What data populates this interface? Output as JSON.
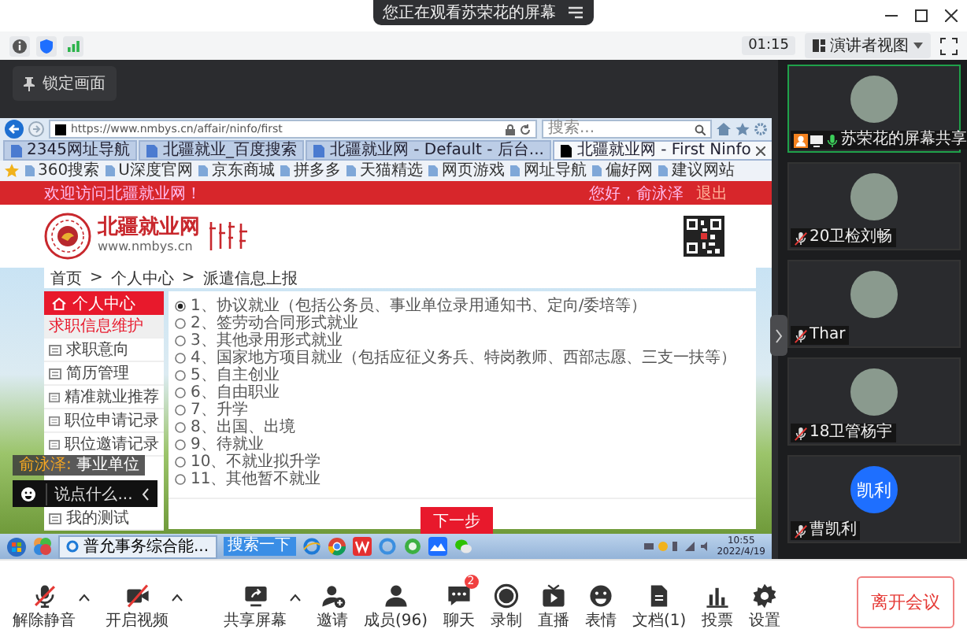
{
  "banner": {
    "text": "您正在观看苏荣花的屏幕"
  },
  "toolbar": {
    "timer": "01:15",
    "view_button": "演讲者视图"
  },
  "lock_button": "锁定画面",
  "browser": {
    "url": "https://www.nmbys.cn/affair/ninfo/first",
    "search_placeholder": "搜索...",
    "tabs": [
      {
        "label": "2345网址导航",
        "selected": false
      },
      {
        "label": "北疆就业_百度搜索",
        "selected": false
      },
      {
        "label": "北疆就业网 - Default - 后台...",
        "selected": false
      },
      {
        "label": "北疆就业网 - First Ninfo",
        "selected": true
      }
    ],
    "favorites": [
      "360搜索",
      "U深度官网",
      "京东商城",
      "拼多多",
      "天猫精选",
      "网页游戏",
      "网址导航",
      "偏好网",
      "建议网站"
    ]
  },
  "site": {
    "welcome": "欢迎访问北疆就业网！",
    "greeting": "您好，俞泳泽",
    "logout": "退出",
    "logo_title": "北疆就业网",
    "logo_url": "www.nmbys.cn"
  },
  "breadcrumb": {
    "separator": ">",
    "items": [
      "首页",
      "个人中心",
      "派遣信息上报"
    ]
  },
  "sidebar": {
    "title": "个人中心",
    "items": [
      {
        "label": "求职信息维护",
        "selected": true
      },
      {
        "label": "求职意向",
        "selected": false
      },
      {
        "label": "简历管理",
        "selected": false
      },
      {
        "label": "精准就业推荐",
        "selected": false
      },
      {
        "label": "职位申请记录",
        "selected": false
      },
      {
        "label": "职位邀请记录",
        "selected": false
      },
      {
        "label": "我的测试",
        "selected": false
      }
    ]
  },
  "form": {
    "options": [
      {
        "label": "1、协议就业（包括公务员、事业单位录用通知书、定向/委培等）",
        "selected": true
      },
      {
        "label": "2、签劳动合同形式就业",
        "selected": false
      },
      {
        "label": "3、其他录用形式就业",
        "selected": false
      },
      {
        "label": "4、国家地方项目就业（包括应征义务兵、特岗教师、西部志愿、三支一扶等）",
        "selected": false
      },
      {
        "label": "5、自主创业",
        "selected": false
      },
      {
        "label": "6、自由职业",
        "selected": false
      },
      {
        "label": "7、升学",
        "selected": false
      },
      {
        "label": "8、出国、出境",
        "selected": false
      },
      {
        "label": "9、待就业",
        "selected": false
      },
      {
        "label": "10、不就业拟升学",
        "selected": false
      },
      {
        "label": "11、其他暂不就业",
        "selected": false
      }
    ],
    "next_button": "下一步"
  },
  "taskbar": {
    "task": "普允事务综合能...",
    "search_button": "搜索一下",
    "time": "10:55",
    "date": "2022/4/19"
  },
  "chat_overlay": {
    "sender": "俞泳泽:",
    "message": "事业单位",
    "placeholder": "说点什么..."
  },
  "participants": [
    {
      "name": "苏荣花的屏幕共享",
      "kind": "sharer",
      "muted": false,
      "highlighted": true
    },
    {
      "name": "20卫检刘畅",
      "kind": "photo",
      "muted": true,
      "highlighted": false
    },
    {
      "name": "Thar",
      "kind": "photo",
      "muted": true,
      "highlighted": false
    },
    {
      "name": "18卫管杨宇",
      "kind": "photo",
      "muted": true,
      "highlighted": false
    },
    {
      "name": "曹凯利",
      "kind": "initials",
      "avatar_text": "凯利",
      "muted": true,
      "highlighted": false
    }
  ],
  "controls": {
    "media": [
      {
        "label": "解除静音",
        "kind": "mic_off",
        "menu": true
      },
      {
        "label": "开启视频",
        "kind": "video_off",
        "menu": true
      }
    ],
    "meeting": [
      {
        "label": "共享屏幕",
        "kind": "share",
        "menu": true
      },
      {
        "label": "邀请",
        "kind": "invite",
        "menu": false
      },
      {
        "label": "成员(96)",
        "kind": "members",
        "menu": false
      },
      {
        "label": "聊天",
        "kind": "chat",
        "menu": false,
        "badge": "2"
      },
      {
        "label": "录制",
        "kind": "record",
        "menu": false
      },
      {
        "label": "直播",
        "kind": "live",
        "menu": false
      },
      {
        "label": "表情",
        "kind": "emoji",
        "menu": false
      },
      {
        "label": "文档(1)",
        "kind": "docs",
        "menu": false
      },
      {
        "label": "投票",
        "kind": "vote",
        "menu": false
      },
      {
        "label": "设置",
        "kind": "settings",
        "menu": false
      }
    ]
  },
  "leave_button": "离开会议"
}
